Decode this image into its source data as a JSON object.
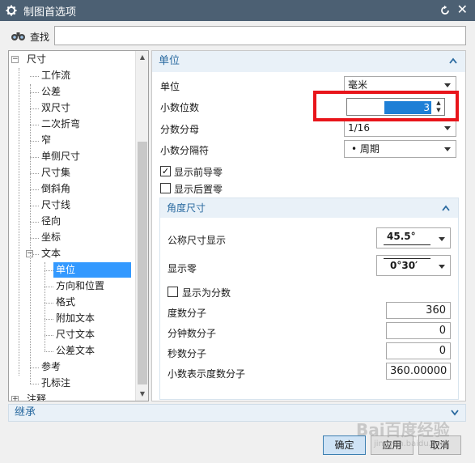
{
  "window": {
    "title": "制图首选项"
  },
  "search": {
    "label": "查找",
    "value": ""
  },
  "tree": {
    "items": [
      {
        "label": "尺寸",
        "level": 0,
        "expander": "−"
      },
      {
        "label": "工作流",
        "level": 1
      },
      {
        "label": "公差",
        "level": 1
      },
      {
        "label": "双尺寸",
        "level": 1
      },
      {
        "label": "二次折弯",
        "level": 1
      },
      {
        "label": "窄",
        "level": 1
      },
      {
        "label": "单侧尺寸",
        "level": 1
      },
      {
        "label": "尺寸集",
        "level": 1
      },
      {
        "label": "倒斜角",
        "level": 1
      },
      {
        "label": "尺寸线",
        "level": 1
      },
      {
        "label": "径向",
        "level": 1
      },
      {
        "label": "坐标",
        "level": 1
      },
      {
        "label": "文本",
        "level": 1,
        "expander": "−"
      },
      {
        "label": "单位",
        "level": 2,
        "selected": true
      },
      {
        "label": "方向和位置",
        "level": 2
      },
      {
        "label": "格式",
        "level": 2
      },
      {
        "label": "附加文本",
        "level": 2
      },
      {
        "label": "尺寸文本",
        "level": 2
      },
      {
        "label": "公差文本",
        "level": 2
      },
      {
        "label": "参考",
        "level": 1
      },
      {
        "label": "孔标注",
        "level": 1
      },
      {
        "label": "注释",
        "level": 0,
        "expander": "+"
      }
    ]
  },
  "units_section": {
    "header": "单位",
    "unit_label": "单位",
    "unit_value": "毫米",
    "decimal_places_label": "小数位数",
    "decimal_places_value": "3",
    "fraction_denominator_label": "分数分母",
    "fraction_denominator_value": "1/16",
    "decimal_separator_label": "小数分隔符",
    "decimal_separator_value": "•  周期",
    "show_leading_zeros_label": "显示前导零",
    "show_leading_zeros_checked": true,
    "show_trailing_zeros_label": "显示后置零",
    "show_trailing_zeros_checked": false
  },
  "angle_section": {
    "header": "角度尺寸",
    "nominal_display_label": "公称尺寸显示",
    "nominal_display_value": "45.5°",
    "show_zeros_label": "显示零",
    "show_zeros_value": "0°30′",
    "show_as_fraction_label": "显示为分数",
    "show_as_fraction_checked": false,
    "degree_numerator_label": "度数分子",
    "degree_numerator_value": "360",
    "minute_numerator_label": "分钟数分子",
    "minute_numerator_value": "0",
    "second_numerator_label": "秒数分子",
    "second_numerator_value": "0",
    "decimal_degree_numerator_label": "小数表示度数分子",
    "decimal_degree_numerator_value": "360.00000"
  },
  "inherit": {
    "label": "继承"
  },
  "buttons": {
    "ok": "确定",
    "apply": "应用",
    "cancel": "取消"
  },
  "watermark": {
    "text": "Bai百度经验",
    "url_text": "jingyan.baidu.com"
  },
  "colors": {
    "titlebar": "#4c6073",
    "accent": "#2a6aa0",
    "selection": "#3399ff",
    "highlight": "#e8151b"
  }
}
